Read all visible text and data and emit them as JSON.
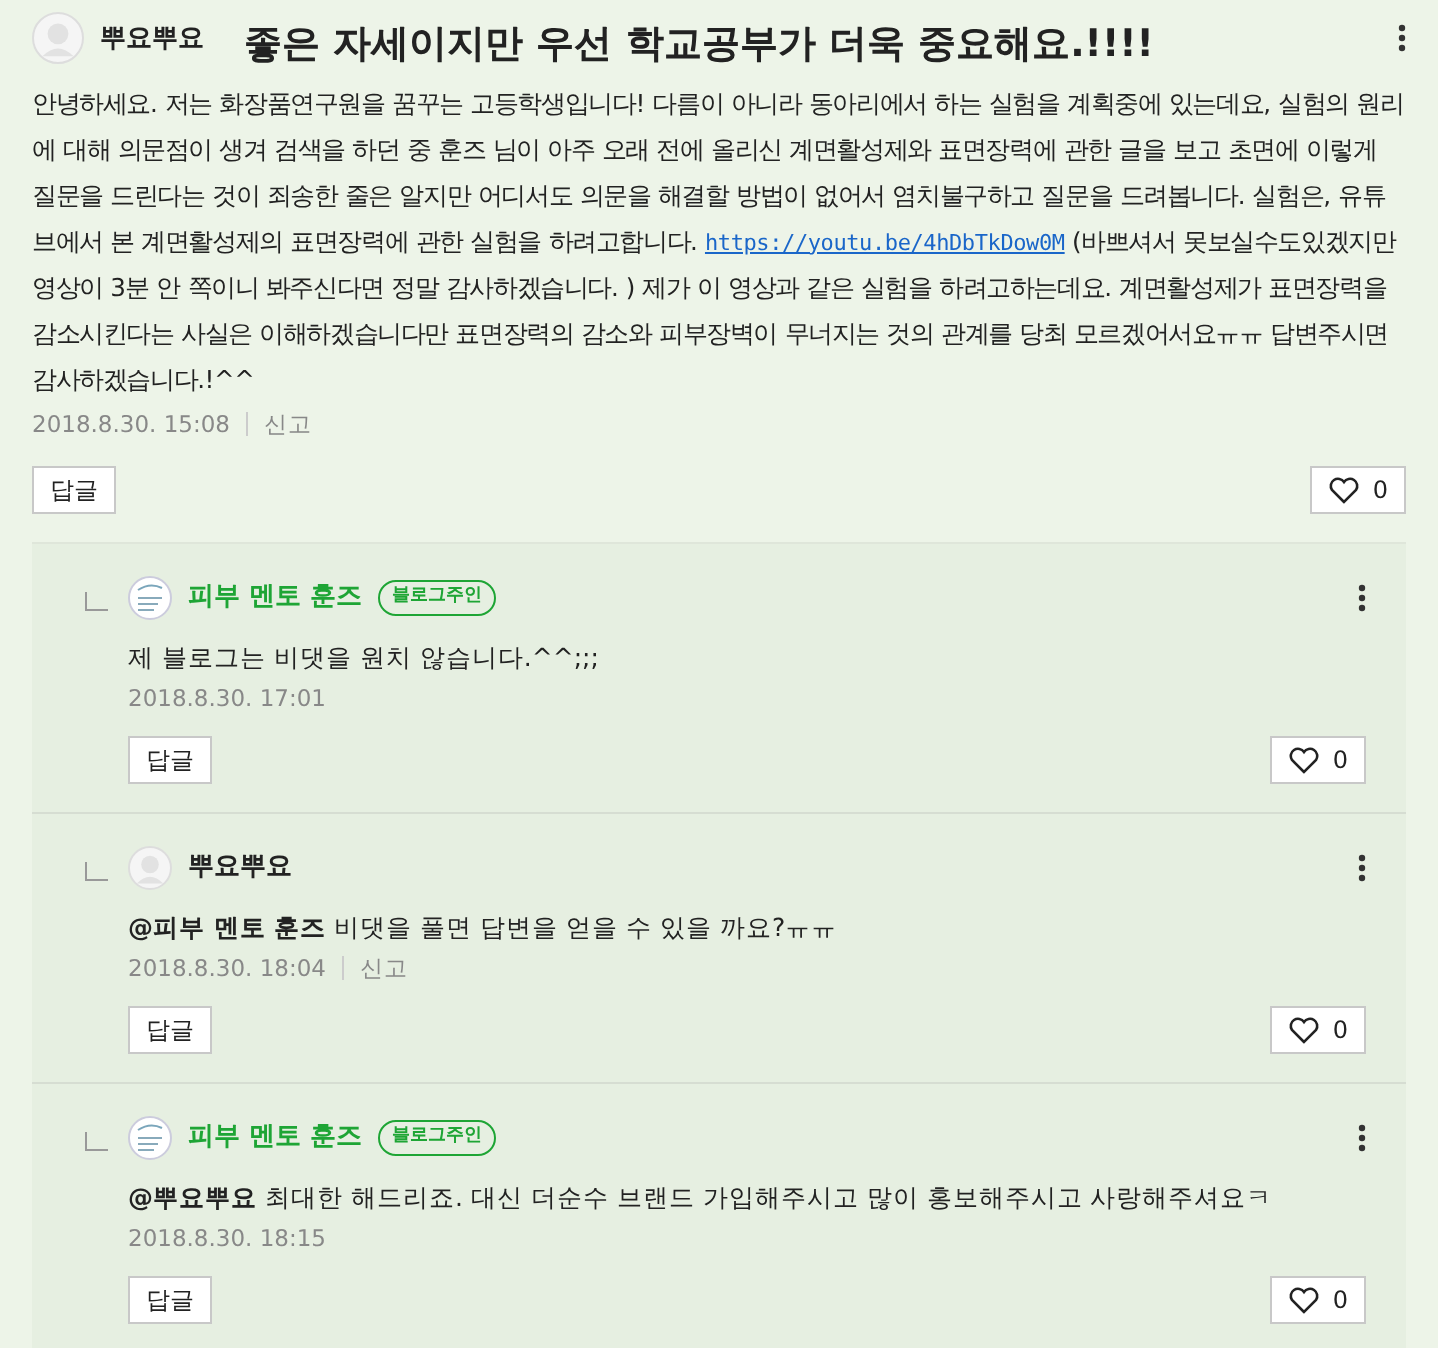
{
  "comment": {
    "author": "뿌요뿌요",
    "avatar": {
      "kind": "default"
    },
    "title": "좋은 자세이지만 우선 학교공부가 더욱 중요해요.!!!!",
    "body_before": "안녕하세요. 저는 화장품연구원을 꿈꾸는 고등학생입니다! 다름이 아니라 동아리에서 하는 실험을 계획중에 있는데요, 실험의 원리에 대해 의문점이 생겨 검색을 하던 중 훈즈 님이 아주 오래 전에 올리신 계면활성제와 표면장력에 관한 글을 보고 초면에 이렇게 질문을 드린다는 것이 죄송한 줄은 알지만 어디서도 의문을 해결할 방법이 없어서 염치불구하고 질문을 드려봅니다. 실험은, 유튜브에서 본 계면활성제의 표면장력에 관한 실험을 하려고합니다.",
    "link": "https://youtu.be/4hDbTkDow0M",
    "body_after": "(바쁘셔서 못보실수도있겠지만 영상이 3분 안 쪽이니 봐주신다면 정말 감사하겠습니다. ) 제가 이 영상과 같은 실험을 하려고하는데요. 계면활성제가 표면장력을 감소시킨다는 사실은 이해하겠습니다만 표면장력의 감소와 피부장벽이 무너지는 것의 관계를 당최 모르겠어서요ㅠㅠ 답변주시면 감사하겠습니다.!^^",
    "date": "2018.8.30. 15:08",
    "report": "신고",
    "reply_button": "답글",
    "likes": "0"
  },
  "replies": [
    {
      "author": "피부 멘토 훈즈",
      "avatar": {
        "kind": "logo"
      },
      "owner_badge": "블로그주인",
      "text": "제 블로그는 비댓을 원치 않습니다.^^;;;",
      "date": "2018.8.30. 17:01",
      "reply_button": "답글",
      "likes": "0"
    },
    {
      "author": "뿌요뿌요",
      "avatar": {
        "kind": "default"
      },
      "mention": "@피부 멘토 훈즈",
      "text": "비댓을 풀면 답변을 얻을 수 있을 까요?ㅠㅠ",
      "date": "2018.8.30. 18:04",
      "report": "신고",
      "reply_button": "답글",
      "likes": "0"
    },
    {
      "author": "피부 멘토 훈즈",
      "avatar": {
        "kind": "logo"
      },
      "owner_badge": "블로그주인",
      "mention": "@뿌요뿌요",
      "text": "최대한 해드리죠. 대신 더순수 브랜드 가입해주시고 많이 홍보해주시고 사랑해주셔요ㅋ",
      "date": "2018.8.30. 18:15",
      "reply_button": "답글",
      "likes": "0"
    }
  ]
}
